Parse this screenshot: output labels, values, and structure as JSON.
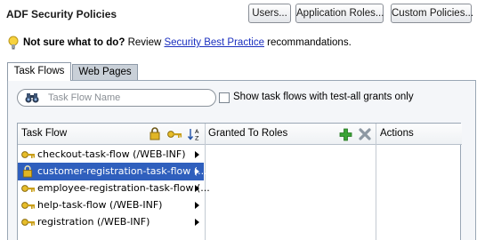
{
  "header": {
    "title": "ADF Security Policies",
    "buttons": [
      "Users...",
      "Application Roles...",
      "Custom Policies..."
    ]
  },
  "help": {
    "bold": "Not sure what to do?",
    "prefix": "Review",
    "link": "Security Best Practice",
    "suffix": "recommandations."
  },
  "tabs": [
    {
      "label": "Task Flows",
      "active": true
    },
    {
      "label": "Web Pages",
      "active": false
    }
  ],
  "filter": {
    "search_placeholder": "Task Flow Name",
    "checkbox_label": "Show task flows with test-all grants only",
    "checked": false
  },
  "table": {
    "columns": [
      "Task Flow",
      "Granted To Roles",
      "Actions"
    ],
    "rows": [
      {
        "label": "checkout-task-flow (/WEB-INF)",
        "icon": "key-icon",
        "selected": false
      },
      {
        "label": "customer-registration-task-flow (...)",
        "icon": "lock-icon",
        "selected": true
      },
      {
        "label": "employee-registration-task-flow (...",
        "icon": "key-icon",
        "selected": false
      },
      {
        "label": "help-task-flow (/WEB-INF)",
        "icon": "key-icon",
        "selected": false
      },
      {
        "label": "registration (/WEB-INF)",
        "icon": "key-icon",
        "selected": false
      }
    ]
  },
  "colors": {
    "selection": "#2f5fbd",
    "add": "#3aa335",
    "delete": "#8d98a3"
  }
}
